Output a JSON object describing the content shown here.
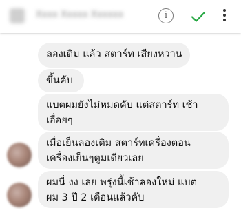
{
  "header": {
    "title": "Xxxx Xxxxx Xxxxxx",
    "info_icon": "info-icon",
    "check_icon": "check-icon",
    "more_icon": "more-vert-icon",
    "info_glyph": "i"
  },
  "colors": {
    "accent": "#27a844",
    "bubble": "#f0f0f0",
    "text": "#111111"
  },
  "messages": [
    {
      "lines": [
        "ลองเติม แล้ว สตาร์ท เสียงหวาน"
      ]
    },
    {
      "lines": [
        "ขึ้นคับ"
      ]
    },
    {
      "lines": [
        "แบตผมยังไม่หมดคับ แต่สตาร์ท เช้า",
        "เอื่อยๆ"
      ]
    },
    {
      "lines": [
        "เมื่อเย็นลองเติม สตาร์ทเครื่องตอน",
        "เครื่องเย็นๆตูมเดียวเลย"
      ]
    },
    {
      "lines": [
        "ผมนี่ งง เลย พรุ่งนี้เช้าลองใหม่ แบต",
        "ผม 3 ปี 2 เดือนแล้วคับ"
      ]
    }
  ]
}
